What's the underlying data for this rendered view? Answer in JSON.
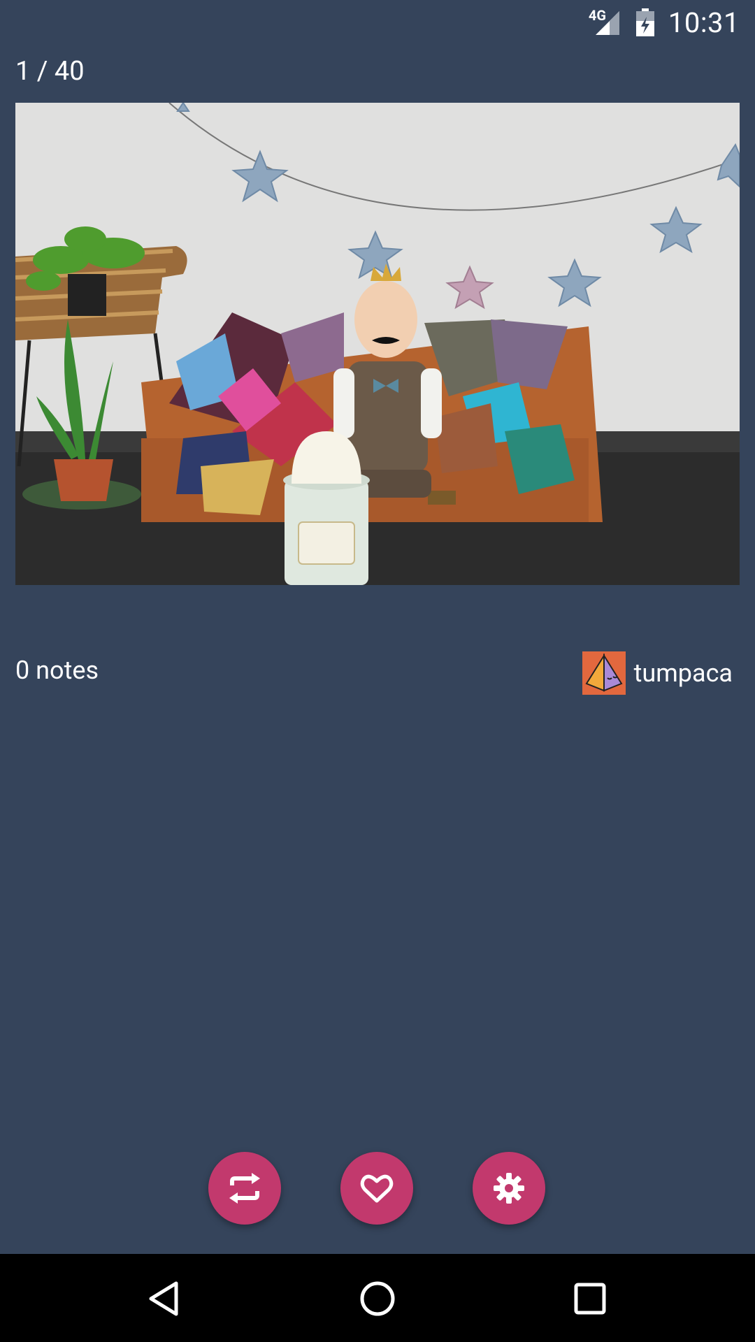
{
  "status_bar": {
    "time": "10:31",
    "network_label": "4G",
    "signal_icon": "cell-signal-icon",
    "battery_icon": "battery-charging-icon"
  },
  "viewer": {
    "counter": "1 / 40"
  },
  "post": {
    "image_icon": "photo-birthday-scene",
    "notes": "0 notes",
    "author": {
      "name": "tumpaca",
      "avatar_icon": "pyramid-avatar-icon",
      "avatar_color": "#e2683e"
    }
  },
  "actions": [
    {
      "name": "reblog",
      "icon": "reblog-icon"
    },
    {
      "name": "like",
      "icon": "heart-icon"
    },
    {
      "name": "settings",
      "icon": "gear-icon"
    }
  ],
  "nav": {
    "back_icon": "back-triangle-icon",
    "home_icon": "home-circle-icon",
    "recents_icon": "recents-square-icon"
  },
  "colors": {
    "background": "#35445b",
    "accent": "#c2396d",
    "nav_bar": "#000000"
  }
}
